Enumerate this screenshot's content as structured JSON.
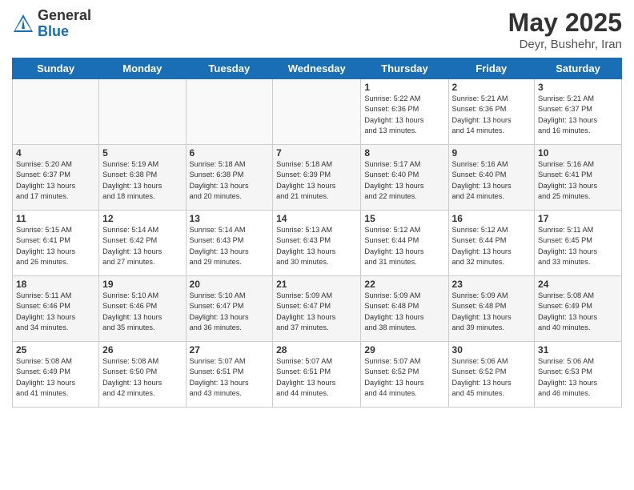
{
  "header": {
    "logo_general": "General",
    "logo_blue": "Blue",
    "month_title": "May 2025",
    "subtitle": "Deyr, Bushehr, Iran"
  },
  "days_of_week": [
    "Sunday",
    "Monday",
    "Tuesday",
    "Wednesday",
    "Thursday",
    "Friday",
    "Saturday"
  ],
  "weeks": [
    [
      {
        "day": "",
        "info": ""
      },
      {
        "day": "",
        "info": ""
      },
      {
        "day": "",
        "info": ""
      },
      {
        "day": "",
        "info": ""
      },
      {
        "day": "1",
        "info": "Sunrise: 5:22 AM\nSunset: 6:36 PM\nDaylight: 13 hours\nand 13 minutes."
      },
      {
        "day": "2",
        "info": "Sunrise: 5:21 AM\nSunset: 6:36 PM\nDaylight: 13 hours\nand 14 minutes."
      },
      {
        "day": "3",
        "info": "Sunrise: 5:21 AM\nSunset: 6:37 PM\nDaylight: 13 hours\nand 16 minutes."
      }
    ],
    [
      {
        "day": "4",
        "info": "Sunrise: 5:20 AM\nSunset: 6:37 PM\nDaylight: 13 hours\nand 17 minutes."
      },
      {
        "day": "5",
        "info": "Sunrise: 5:19 AM\nSunset: 6:38 PM\nDaylight: 13 hours\nand 18 minutes."
      },
      {
        "day": "6",
        "info": "Sunrise: 5:18 AM\nSunset: 6:38 PM\nDaylight: 13 hours\nand 20 minutes."
      },
      {
        "day": "7",
        "info": "Sunrise: 5:18 AM\nSunset: 6:39 PM\nDaylight: 13 hours\nand 21 minutes."
      },
      {
        "day": "8",
        "info": "Sunrise: 5:17 AM\nSunset: 6:40 PM\nDaylight: 13 hours\nand 22 minutes."
      },
      {
        "day": "9",
        "info": "Sunrise: 5:16 AM\nSunset: 6:40 PM\nDaylight: 13 hours\nand 24 minutes."
      },
      {
        "day": "10",
        "info": "Sunrise: 5:16 AM\nSunset: 6:41 PM\nDaylight: 13 hours\nand 25 minutes."
      }
    ],
    [
      {
        "day": "11",
        "info": "Sunrise: 5:15 AM\nSunset: 6:41 PM\nDaylight: 13 hours\nand 26 minutes."
      },
      {
        "day": "12",
        "info": "Sunrise: 5:14 AM\nSunset: 6:42 PM\nDaylight: 13 hours\nand 27 minutes."
      },
      {
        "day": "13",
        "info": "Sunrise: 5:14 AM\nSunset: 6:43 PM\nDaylight: 13 hours\nand 29 minutes."
      },
      {
        "day": "14",
        "info": "Sunrise: 5:13 AM\nSunset: 6:43 PM\nDaylight: 13 hours\nand 30 minutes."
      },
      {
        "day": "15",
        "info": "Sunrise: 5:12 AM\nSunset: 6:44 PM\nDaylight: 13 hours\nand 31 minutes."
      },
      {
        "day": "16",
        "info": "Sunrise: 5:12 AM\nSunset: 6:44 PM\nDaylight: 13 hours\nand 32 minutes."
      },
      {
        "day": "17",
        "info": "Sunrise: 5:11 AM\nSunset: 6:45 PM\nDaylight: 13 hours\nand 33 minutes."
      }
    ],
    [
      {
        "day": "18",
        "info": "Sunrise: 5:11 AM\nSunset: 6:46 PM\nDaylight: 13 hours\nand 34 minutes."
      },
      {
        "day": "19",
        "info": "Sunrise: 5:10 AM\nSunset: 6:46 PM\nDaylight: 13 hours\nand 35 minutes."
      },
      {
        "day": "20",
        "info": "Sunrise: 5:10 AM\nSunset: 6:47 PM\nDaylight: 13 hours\nand 36 minutes."
      },
      {
        "day": "21",
        "info": "Sunrise: 5:09 AM\nSunset: 6:47 PM\nDaylight: 13 hours\nand 37 minutes."
      },
      {
        "day": "22",
        "info": "Sunrise: 5:09 AM\nSunset: 6:48 PM\nDaylight: 13 hours\nand 38 minutes."
      },
      {
        "day": "23",
        "info": "Sunrise: 5:09 AM\nSunset: 6:48 PM\nDaylight: 13 hours\nand 39 minutes."
      },
      {
        "day": "24",
        "info": "Sunrise: 5:08 AM\nSunset: 6:49 PM\nDaylight: 13 hours\nand 40 minutes."
      }
    ],
    [
      {
        "day": "25",
        "info": "Sunrise: 5:08 AM\nSunset: 6:49 PM\nDaylight: 13 hours\nand 41 minutes."
      },
      {
        "day": "26",
        "info": "Sunrise: 5:08 AM\nSunset: 6:50 PM\nDaylight: 13 hours\nand 42 minutes."
      },
      {
        "day": "27",
        "info": "Sunrise: 5:07 AM\nSunset: 6:51 PM\nDaylight: 13 hours\nand 43 minutes."
      },
      {
        "day": "28",
        "info": "Sunrise: 5:07 AM\nSunset: 6:51 PM\nDaylight: 13 hours\nand 44 minutes."
      },
      {
        "day": "29",
        "info": "Sunrise: 5:07 AM\nSunset: 6:52 PM\nDaylight: 13 hours\nand 44 minutes."
      },
      {
        "day": "30",
        "info": "Sunrise: 5:06 AM\nSunset: 6:52 PM\nDaylight: 13 hours\nand 45 minutes."
      },
      {
        "day": "31",
        "info": "Sunrise: 5:06 AM\nSunset: 6:53 PM\nDaylight: 13 hours\nand 46 minutes."
      }
    ]
  ]
}
